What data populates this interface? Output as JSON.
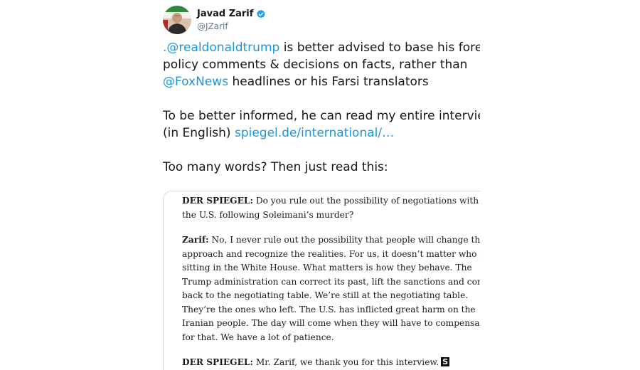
{
  "tweet": {
    "display_name": "Javad Zarif",
    "handle": "@JZarif",
    "verified_icon": "verified-badge-icon",
    "colors": {
      "link": "#1b95e0",
      "text": "#14171a",
      "handle": "#657786"
    },
    "text": {
      "p1_mention": ".@realdonaldtrump",
      "p1_rest": " is better advised to base his foreign",
      "p1_line2": "policy comments & decisions on facts, rather than",
      "p1_mention2": "@FoxNews",
      "p1_line3_rest": " headlines or his Farsi translators",
      "p2_line1": "To be better informed, he can read my entire interview",
      "p2_prefix": "(in English) ",
      "p2_link": "spiegel.de/international/…",
      "p3": "Too many words? Then just read this:"
    }
  },
  "quote": {
    "q1_speaker": "DER SPIEGEL:",
    "q1_line1": " Do you rule out the possibility of negotiations with",
    "q1_line2": "the U.S. following Soleimani’s murder?",
    "a1_speaker": "Zarif:",
    "a1_line1": " No, I never rule out the possibility that people will change their",
    "a1_line2": "approach and recognize the realities. For us, it doesn’t matter who is",
    "a1_line3": "sitting in the White House. What matters is how they behave. The",
    "a1_line4": "Trump administration can correct its past, lift the sanctions and come",
    "a1_line5": "back to the negotiating table. We’re still at the negotiating table.",
    "a1_line6": "They’re the ones who left. The U.S. has inflicted great harm on the",
    "a1_line7": "Iranian people. The day will come when they will have to compensate",
    "a1_line8": "for that. We have a lot of patience.",
    "q2_speaker": "DER SPIEGEL:",
    "q2_line1": " Mr. Zarif, we thank you for this interview.",
    "end_mark": "S"
  }
}
